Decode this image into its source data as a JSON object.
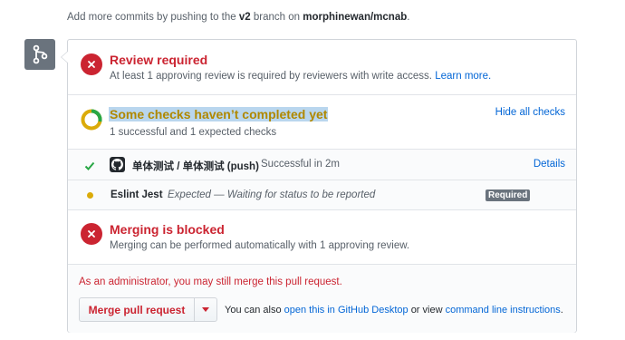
{
  "top_note": {
    "prefix": "Add more commits by pushing to the",
    "branch": "v2",
    "middle": "branch on",
    "repo": "morphinewan/mcnab",
    "suffix": "."
  },
  "review": {
    "title": "Review required",
    "description": "At least 1 approving review is required by reviewers with write access.",
    "learn_more": "Learn more."
  },
  "checks": {
    "title": "Some checks haven’t completed yet",
    "summary": "1 successful and 1 expected checks",
    "hide_label": "Hide all checks",
    "items": [
      {
        "name": "单体测试 / 单体测试 (push)",
        "status": "Successful in 2m",
        "action": "Details",
        "status_icon": "check-icon",
        "avatar_icon": "github-logo-icon"
      },
      {
        "name": "Eslint Jest",
        "status": "Expected — Waiting for status to be reported",
        "badge": "Required",
        "status_icon": "pending-dot-icon"
      }
    ]
  },
  "merging": {
    "title": "Merging is blocked",
    "description": "Merging can be performed automatically with 1 approving review."
  },
  "admin": {
    "note": "As an administrator, you may still merge this pull request.",
    "merge_button": "Merge pull request",
    "also_prefix": "You can also",
    "desktop_link": "open this in GitHub Desktop",
    "also_middle": "or view",
    "cli_link": "command line instructions",
    "also_suffix": "."
  },
  "colors": {
    "danger": "#cb2431",
    "success": "#28a745",
    "pending": "#dbab09",
    "link": "#0366d6",
    "highlight": "#b9d6ee"
  }
}
